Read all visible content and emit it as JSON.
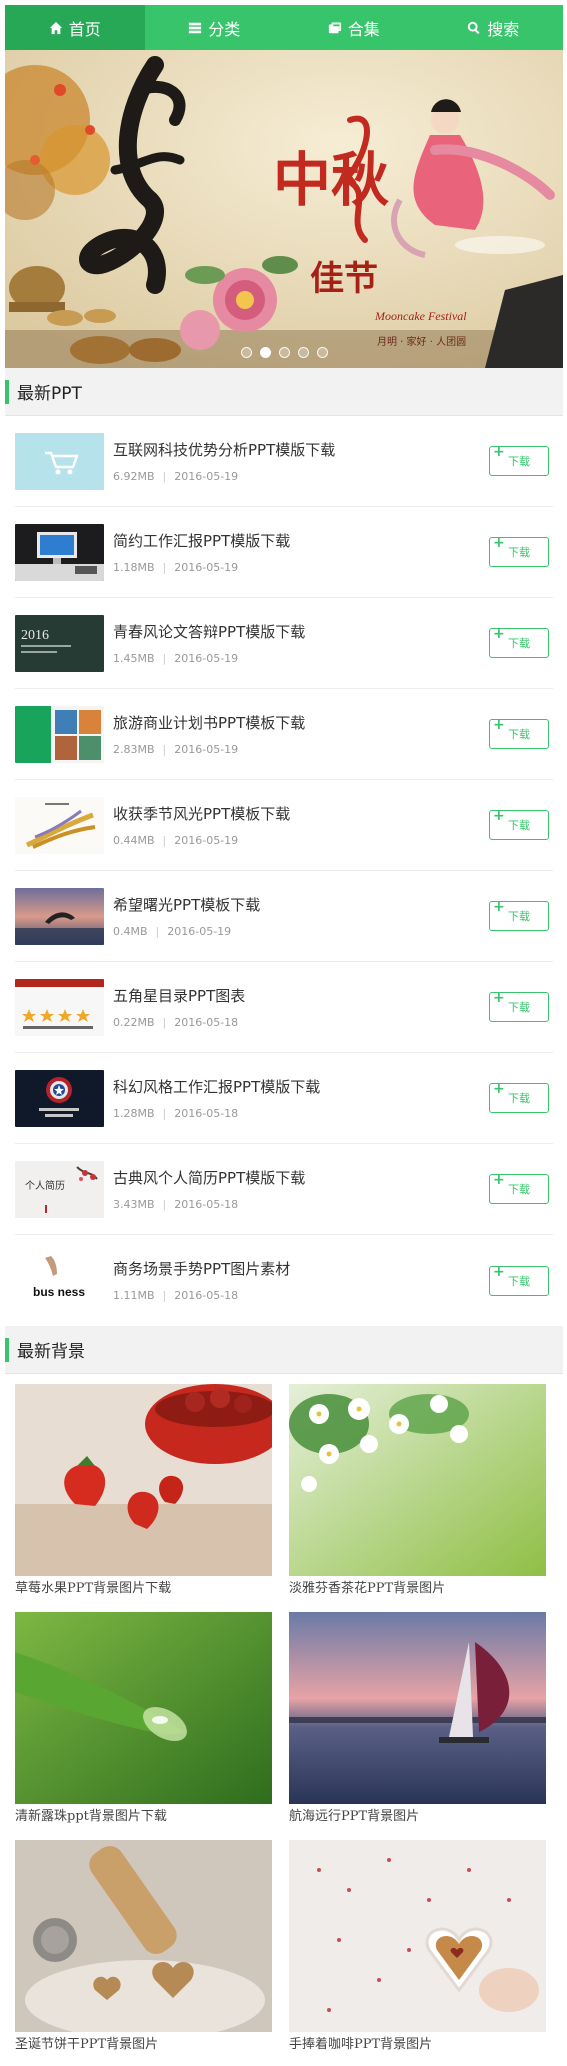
{
  "nav": {
    "items": [
      {
        "label": "首页",
        "icon": "home-icon",
        "active": true
      },
      {
        "label": "分类",
        "icon": "list-icon",
        "active": false
      },
      {
        "label": "合集",
        "icon": "collection-icon",
        "active": false
      },
      {
        "label": "搜索",
        "icon": "search-icon",
        "active": false
      }
    ]
  },
  "banner": {
    "title_line1": "中秋",
    "title_line2": "佳节",
    "subtitle_en": "Mooncake Festival",
    "tagline": "月明 · 家好 · 人团圆",
    "slide_count": 5,
    "active_slide": 1
  },
  "latest_ppt": {
    "heading": "最新PPT",
    "download_label": "下载",
    "items": [
      {
        "title": "互联网科技优势分析PPT模版下载",
        "size": "6.92MB",
        "date": "2016-05-19",
        "thumb": "cart-thumb"
      },
      {
        "title": "简约工作汇报PPT模版下载",
        "size": "1.18MB",
        "date": "2016-05-19",
        "thumb": "computer-thumb"
      },
      {
        "title": "青春风论文答辩PPT模版下载",
        "size": "1.45MB",
        "date": "2016-05-19",
        "thumb": "blackboard-thumb",
        "thumb_text": "2016"
      },
      {
        "title": "旅游商业计划书PPT模板下载",
        "size": "2.83MB",
        "date": "2016-05-19",
        "thumb": "travel-thumb"
      },
      {
        "title": "收获季节风光PPT模板下载",
        "size": "0.44MB",
        "date": "2016-05-19",
        "thumb": "wheat-thumb"
      },
      {
        "title": "希望曙光PPT模板下载",
        "size": "0.4MB",
        "date": "2016-05-19",
        "thumb": "dolphin-thumb"
      },
      {
        "title": "五角星目录PPT图表",
        "size": "0.22MB",
        "date": "2016-05-18",
        "thumb": "stars-thumb"
      },
      {
        "title": "科幻风格工作汇报PPT模版下载",
        "size": "1.28MB",
        "date": "2016-05-18",
        "thumb": "shield-thumb"
      },
      {
        "title": "古典风个人简历PPT模版下载",
        "size": "3.43MB",
        "date": "2016-05-18",
        "thumb": "classic-thumb",
        "thumb_text": "个人简历"
      },
      {
        "title": "商务场景手势PPT图片素材",
        "size": "1.11MB",
        "date": "2016-05-18",
        "thumb": "business-thumb",
        "thumb_text": "bus ness"
      }
    ]
  },
  "latest_bg": {
    "heading": "最新背景",
    "items": [
      {
        "caption": "草莓水果PPT背景图片下载",
        "image": "strawberry-image"
      },
      {
        "caption": "淡雅芬香茶花PPT背景图片",
        "image": "jasmine-image"
      },
      {
        "caption": "清新露珠ppt背景图片下载",
        "image": "dewdrop-image"
      },
      {
        "caption": "航海远行PPT背景图片",
        "image": "sailboat-image"
      },
      {
        "caption": "圣诞节饼干PPT背景图片",
        "image": "cookie-image"
      },
      {
        "caption": "手捧着咖啡PPT背景图片",
        "image": "coffee-image"
      }
    ]
  },
  "colors": {
    "brand": "#37c46b",
    "nav_active": "#27a857"
  }
}
